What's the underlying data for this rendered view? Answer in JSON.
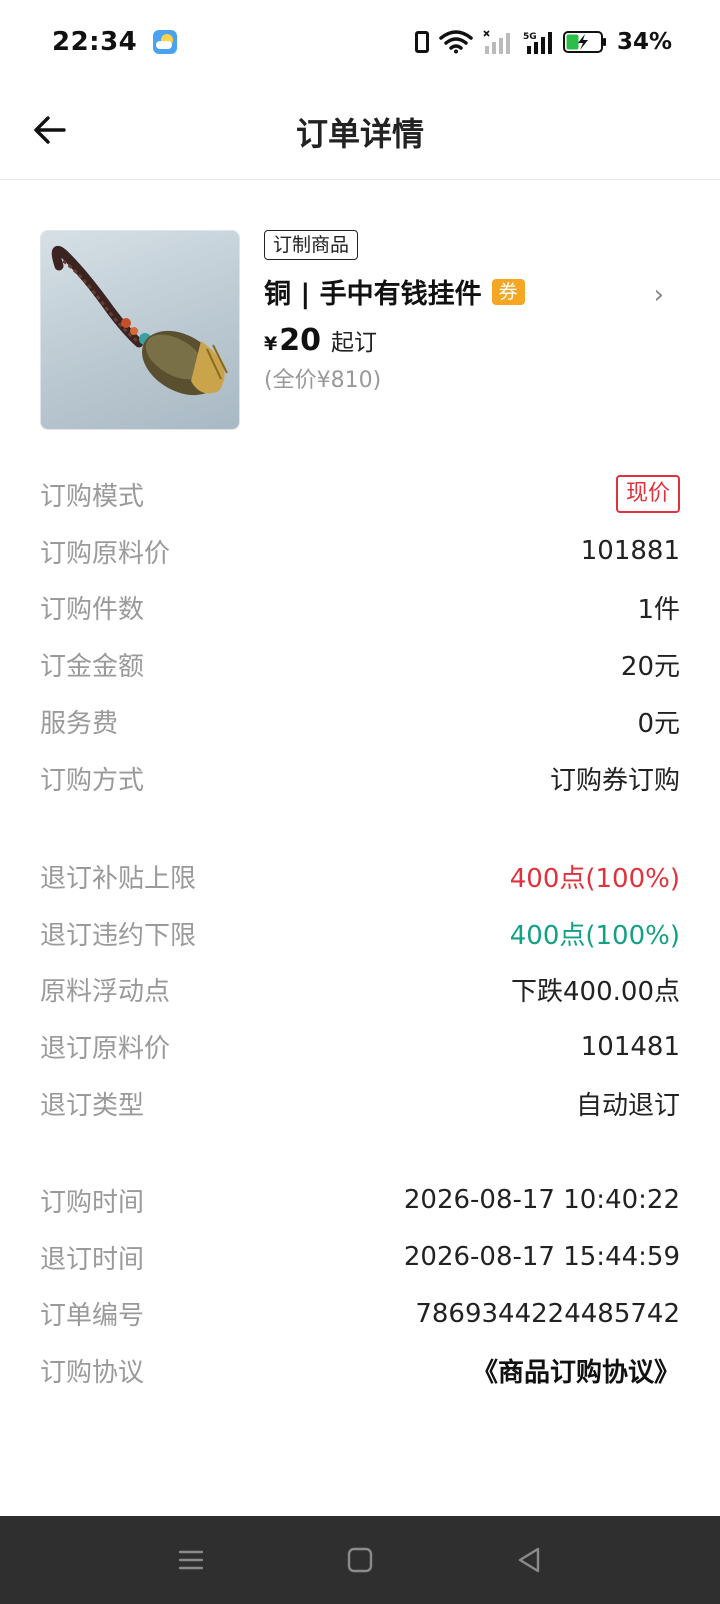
{
  "status_bar": {
    "time": "22:34",
    "battery_percent": "34%",
    "icons": [
      "weather-icon",
      "vibrate-icon",
      "wifi-icon",
      "signal-icon",
      "5g-signal-icon",
      "battery-charging-icon"
    ]
  },
  "nav": {
    "title": "订单详情",
    "back_icon": "arrow-left-icon"
  },
  "product": {
    "tag": "订制商品",
    "title": "铜 | 手中有钱挂件",
    "coupon_badge": "券",
    "price_currency": "¥",
    "price_value": "20",
    "price_suffix": "起订",
    "full_price": "(全价¥810)"
  },
  "order_info": [
    {
      "label": "订购模式",
      "value": "现价"
    },
    {
      "label": "订购原料价",
      "value": "101881"
    },
    {
      "label": "订购件数",
      "value": "1件"
    },
    {
      "label": "订金金额",
      "value": "20元"
    },
    {
      "label": "服务费",
      "value": "0元"
    },
    {
      "label": "订购方式",
      "value": "订购券订购"
    }
  ],
  "refund_info": [
    {
      "label": "退订补贴上限",
      "value": "400点(100%)"
    },
    {
      "label": "退订违约下限",
      "value": "400点(100%)"
    },
    {
      "label": "原料浮动点",
      "value": "下跌400.00点"
    },
    {
      "label": "退订原料价",
      "value": "101481"
    },
    {
      "label": "退订类型",
      "value": "自动退订"
    }
  ],
  "time_info": [
    {
      "label": "订购时间",
      "value": "2026-08-17 10:40:22"
    },
    {
      "label": "退订时间",
      "value": "2026-08-17 15:44:59"
    },
    {
      "label": "订单编号",
      "value": "7869344224485742"
    },
    {
      "label": "订购协议",
      "value": "《商品订购协议》"
    }
  ],
  "colors": {
    "red": "#e0323c",
    "green": "#14a084",
    "coupon": "#f5a623"
  },
  "system_nav": [
    "menu-icon",
    "home-icon",
    "back-triangle-icon"
  ]
}
